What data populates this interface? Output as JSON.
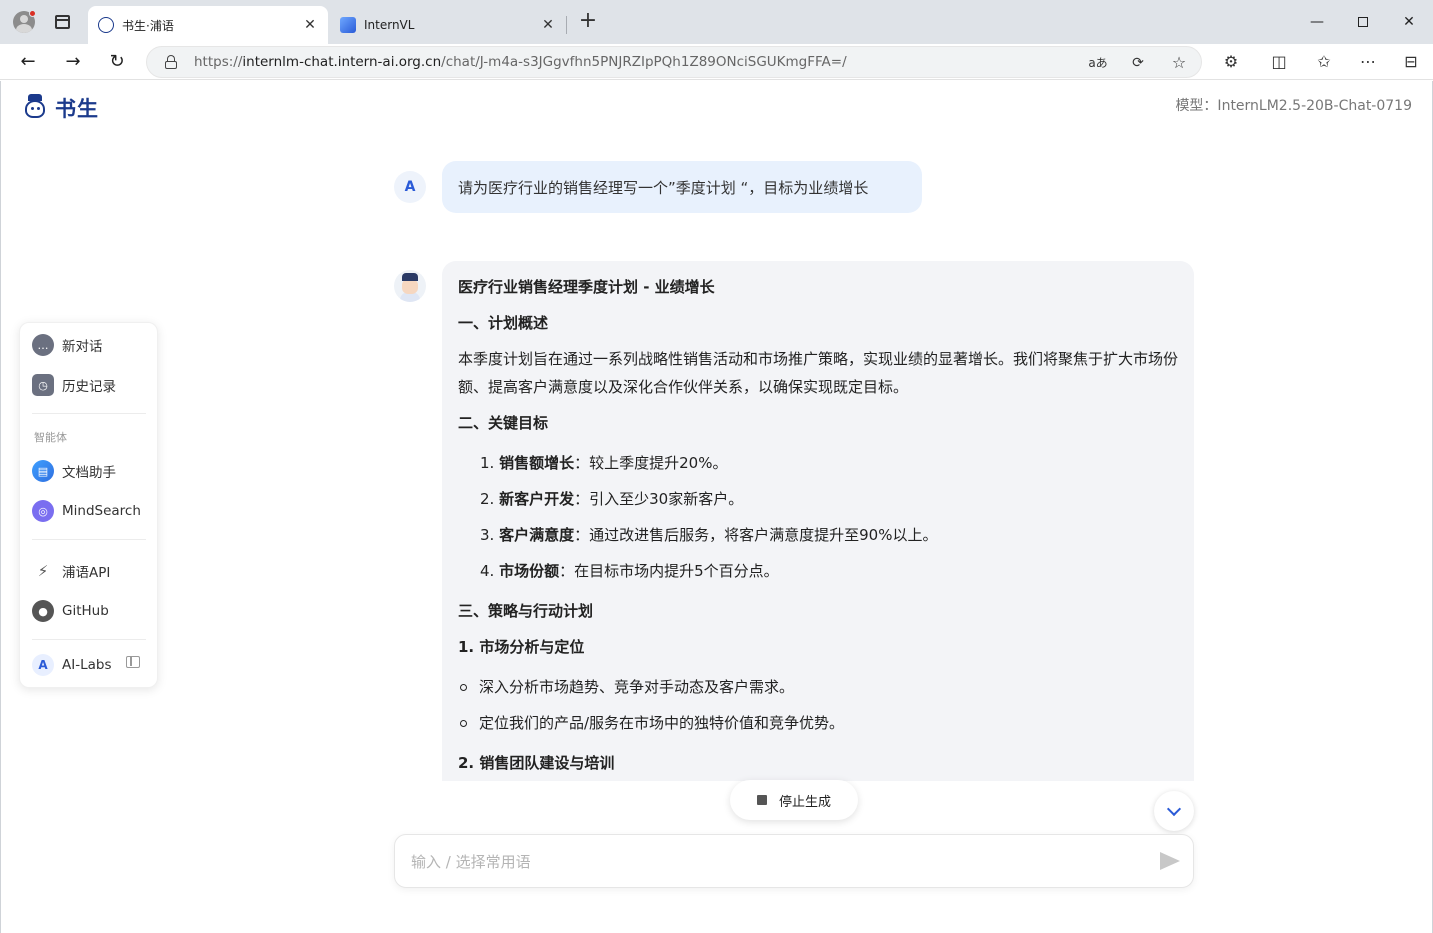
{
  "browser": {
    "tabs": [
      {
        "title": "书生·浦语",
        "active": true
      },
      {
        "title": "InternVL",
        "active": false
      }
    ],
    "url": {
      "scheme": "https://",
      "host": "internlm-chat.intern-ai.org.cn",
      "path": "/chat/J-m4a-s3JGgvfhn5PNJRZIpPQh1Z89ONciSGUKmgFFA=/"
    },
    "read_aloud_label": "aあ"
  },
  "header": {
    "logo_text": "书生",
    "model_label": "模型：InternLM2.5-20B-Chat-0719"
  },
  "sidebar": {
    "items": [
      {
        "label": "新对话",
        "icon": "chat-bubble-icon"
      },
      {
        "label": "历史记录",
        "icon": "history-icon"
      }
    ],
    "section_title": "智能体",
    "agents": [
      {
        "label": "文档助手",
        "icon": "document-assistant-icon"
      },
      {
        "label": "MindSearch",
        "icon": "mindsearch-icon"
      }
    ],
    "links": [
      {
        "label": "浦语API",
        "icon": "plug-icon"
      },
      {
        "label": "GitHub",
        "icon": "github-icon"
      }
    ],
    "user": {
      "avatar": "A",
      "label": "AI-Labs"
    }
  },
  "chat": {
    "user_avatar": "A",
    "user_message": "请为医疗行业的销售经理写一个”季度计划 “，目标为业绩增长",
    "bot": {
      "title": "医疗行业销售经理季度计划 - 业绩增长",
      "section1": "一、计划概述",
      "overview": "本季度计划旨在通过一系列战略性销售活动和市场推广策略，实现业绩的显著增长。我们将聚焦于扩大市场份额、提高客户满意度以及深化合作伙伴关系，以确保实现既定目标。",
      "section2": "二、关键目标",
      "goals": [
        {
          "num": "1.",
          "bold": "销售额增长",
          "text": "：较上季度提升20%。"
        },
        {
          "num": "2.",
          "bold": "新客户开发",
          "text": "：引入至少30家新客户。"
        },
        {
          "num": "3.",
          "bold": "客户满意度",
          "text": "：通过改进售后服务，将客户满意度提升至90%以上。"
        },
        {
          "num": "4.",
          "bold": "市场份额",
          "text": "：在目标市场内提升5个百分点。"
        }
      ],
      "section3": "三、策略与行动计划",
      "sub1": "1. 市场分析与定位",
      "sub1_items": [
        "深入分析市场趋势、竞争对手动态及客户需求。",
        "定位我们的产品/服务在市场中的独特价值和竞争优势。"
      ],
      "sub2": "2. 销售团队建设与培训"
    },
    "stop_label": "停止生成",
    "input_placeholder": "输入 / 选择常用语",
    "input_value": ""
  }
}
